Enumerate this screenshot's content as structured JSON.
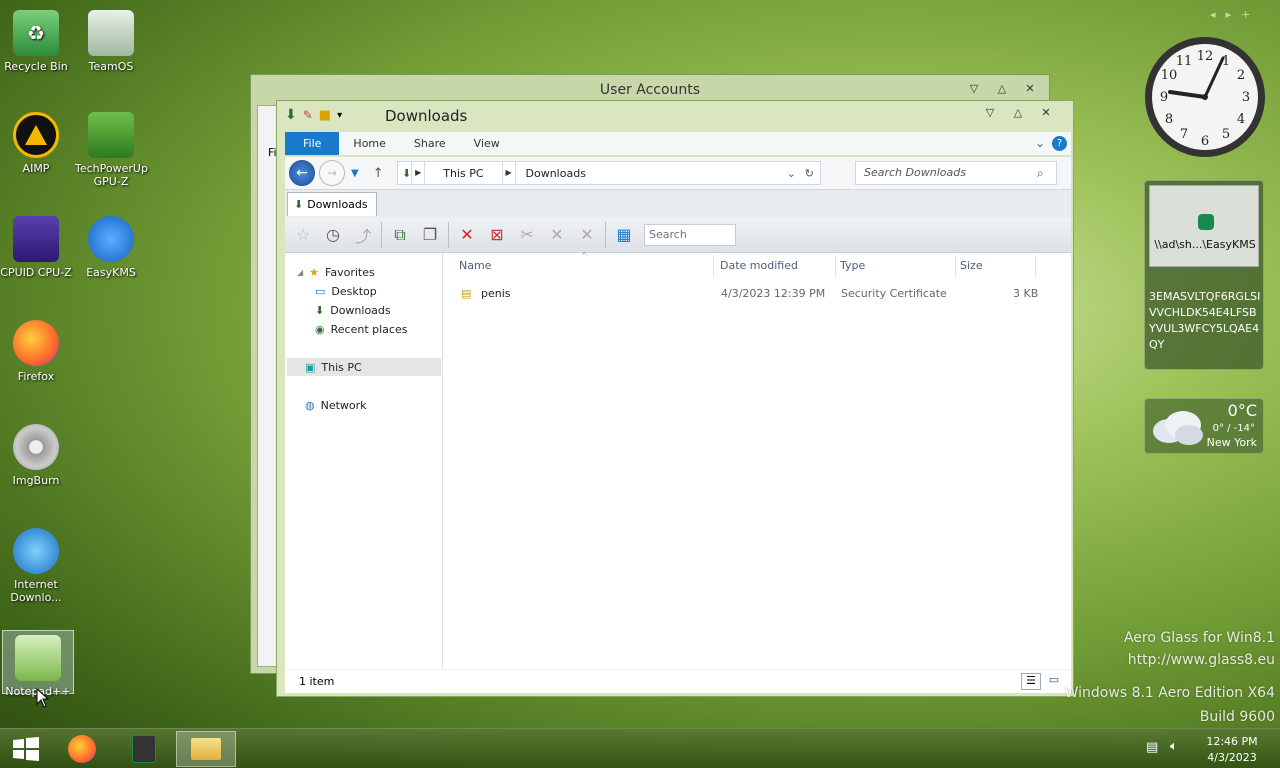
{
  "desktop_icons": [
    {
      "label": "Recycle Bin",
      "icon": "recycle-bin-icon"
    },
    {
      "label": "TeamOS",
      "icon": "teamos-icon"
    },
    {
      "label": "AIMP",
      "icon": "aimp-icon"
    },
    {
      "label": "TechPowerUp GPU-Z",
      "icon": "gpuz-icon"
    },
    {
      "label": "CPUID CPU-Z",
      "icon": "cpuz-icon"
    },
    {
      "label": "EasyKMS",
      "icon": "easykms-icon"
    },
    {
      "label": "Firefox",
      "icon": "firefox-icon"
    },
    {
      "label": "ImgBurn",
      "icon": "imgburn-icon"
    },
    {
      "label": "Internet Downlo...",
      "icon": "idm-icon"
    },
    {
      "label": "Notepad++",
      "icon": "notepadpp-icon"
    }
  ],
  "back_window": {
    "title": "User Accounts",
    "partial_text": "Fi"
  },
  "explorer": {
    "title": "Downloads",
    "ribbon_tabs": [
      "File",
      "Home",
      "Share",
      "View"
    ],
    "breadcrumb": [
      "This PC",
      "Downloads"
    ],
    "search_placeholder": "Search Downloads",
    "tab_label": "Downloads",
    "toolbar_search_placeholder": "Search",
    "nav": {
      "favorites": "Favorites",
      "desktop": "Desktop",
      "downloads": "Downloads",
      "recent": "Recent places",
      "this_pc": "This PC",
      "network": "Network"
    },
    "columns": {
      "name": "Name",
      "date": "Date modified",
      "type": "Type",
      "size": "Size"
    },
    "files": [
      {
        "name": "penis",
        "date": "4/3/2023 12:39 PM",
        "type": "Security Certificate",
        "size": "3 KB"
      }
    ],
    "status": "1 item"
  },
  "gadgets": {
    "kms_title": "\\\\ad\\sh...\\EasyKMS",
    "kms_key": "3EMASVLTQF6RGLSIVVCHLDK54E4LFSBYVUL3WFCY5LQAE4QY",
    "weather_temp": "0°C",
    "weather_range": "0° / -14°",
    "weather_city": "New York"
  },
  "watermark": {
    "line1": "Aero Glass for Win8.1",
    "line2": "http://www.glass8.eu",
    "line3": "Windows 8.1 Aero Edition X64",
    "line4": "Build 9600"
  },
  "taskbar": {
    "time": "12:46 PM",
    "date": "4/3/2023"
  }
}
